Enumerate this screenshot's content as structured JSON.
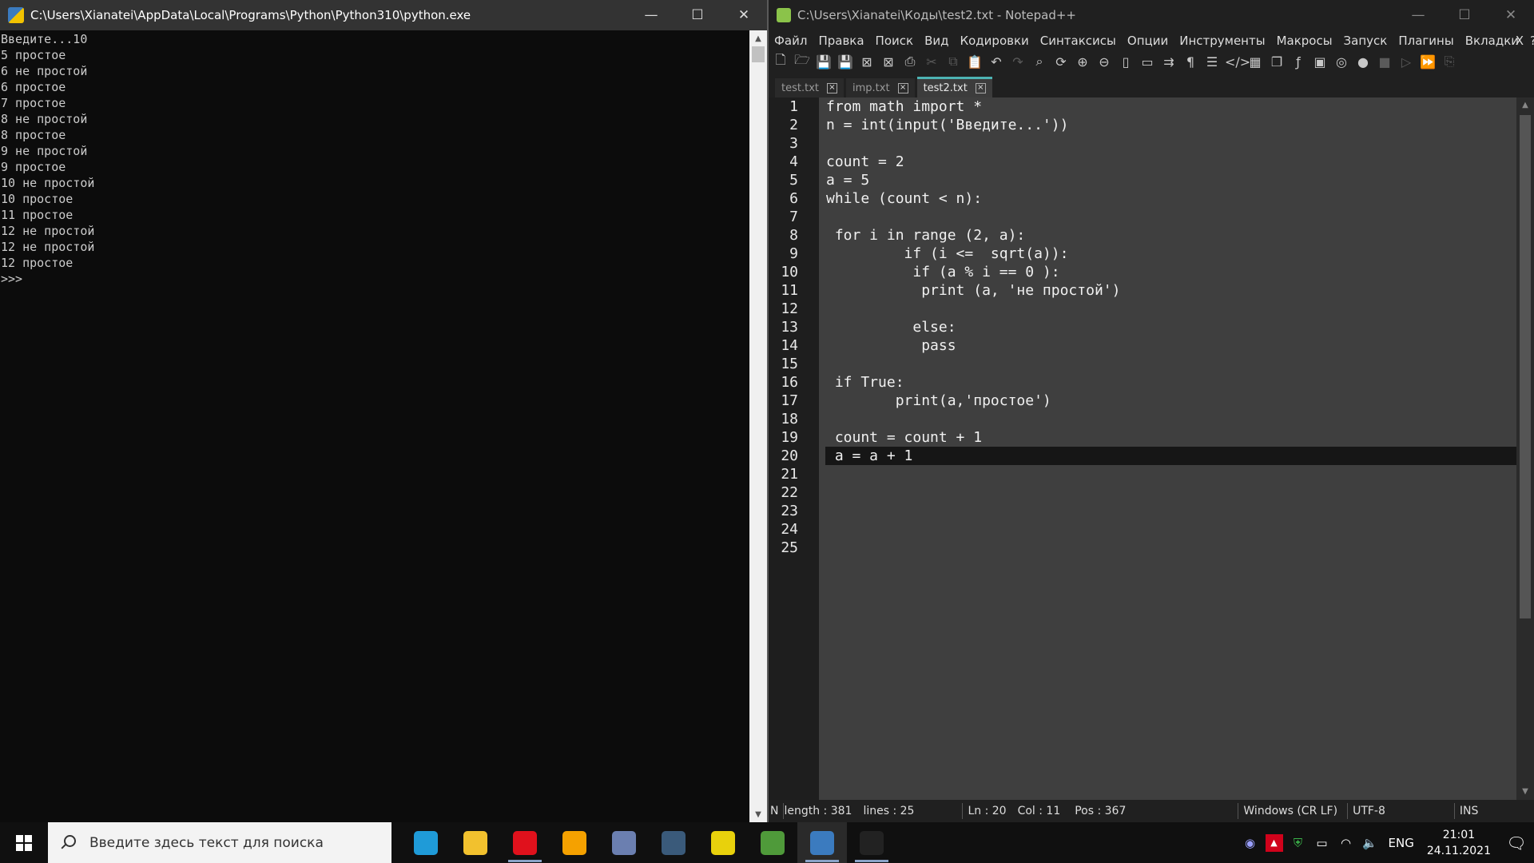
{
  "console": {
    "title": "C:\\Users\\Xianatei\\AppData\\Local\\Programs\\Python\\Python310\\python.exe",
    "lines": [
      "Введите...10",
      "5 простое",
      "6 не простой",
      "6 простое",
      "7 простое",
      "8 не простой",
      "8 простое",
      "9 не простой",
      "9 простое",
      "10 не простой",
      "10 простое",
      "11 простое",
      "12 не простой",
      "12 не простой",
      "12 простое",
      ">>>"
    ]
  },
  "npp": {
    "title": "C:\\Users\\Xianatei\\Коды\\test2.txt - Notepad++",
    "menu": [
      "Файл",
      "Правка",
      "Поиск",
      "Вид",
      "Кодировки",
      "Синтаксисы",
      "Опции",
      "Инструменты",
      "Макросы",
      "Запуск",
      "Плагины",
      "Вкладки",
      "?"
    ],
    "menu_close": "X",
    "tabs": [
      "test.txt",
      "imp.txt",
      "test2.txt"
    ],
    "active_tab": "test2.txt",
    "line_numbers": [
      "1",
      "2",
      "3",
      "4",
      "5",
      "6",
      "7",
      "8",
      "9",
      "10",
      "11",
      "12",
      "13",
      "14",
      "15",
      "16",
      "17",
      "18",
      "19",
      "20",
      "21",
      "22",
      "23",
      "24",
      "25"
    ],
    "code_lines": [
      "from math import *",
      "n = int(input('Введите...'))",
      "",
      "count = 2",
      "a = 5",
      "while (count < n):",
      "",
      " for i in range (2, a):",
      "         if (i <=  sqrt(a)):",
      "          if (a % i == 0 ):",
      "           print (a, 'не простой')",
      "",
      "          else:",
      "           pass",
      "",
      " if True:",
      "        print(a,'простое')",
      "",
      " count = count + 1",
      " a = a + 1",
      "",
      "",
      "",
      "",
      ""
    ],
    "current_line": 20,
    "status": {
      "type": "N",
      "length": "length : 381",
      "lines": "lines : 25",
      "ln": "Ln : 20",
      "col": "Col : 11",
      "pos": "Pos : 367",
      "eol": "Windows (CR LF)",
      "encoding": "UTF-8",
      "mode": "INS"
    }
  },
  "taskbar": {
    "search_placeholder": "Введите здесь текст для поиска",
    "apps": [
      {
        "name": "edge-icon",
        "color": "#1f9bd8",
        "running": false
      },
      {
        "name": "file-explorer-icon",
        "color": "#f2c12e",
        "running": false
      },
      {
        "name": "opera-icon",
        "color": "#e0111c",
        "running": true
      },
      {
        "name": "sticky-app-icon",
        "color": "#f5a100",
        "running": false
      },
      {
        "name": "game-icon",
        "color": "#6b7fb0",
        "running": false
      },
      {
        "name": "globe-app-icon",
        "color": "#3a5a7a",
        "running": false
      },
      {
        "name": "pdf-icon",
        "color": "#e8d10c",
        "running": false
      },
      {
        "name": "image-app-icon",
        "color": "#4f9a3a",
        "running": false
      },
      {
        "name": "python-icon",
        "color": "#3b7bbf",
        "running": true,
        "active": true
      },
      {
        "name": "terminal-icon",
        "color": "#222222",
        "running": true
      }
    ],
    "language": "ENG",
    "time": "21:01",
    "date": "24.11.2021"
  }
}
